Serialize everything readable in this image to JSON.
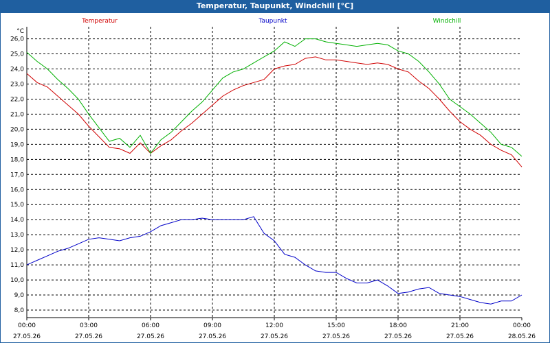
{
  "window": {
    "title": "Temperatur, Taupunkt, Windchill [°C]"
  },
  "colors": {
    "temperatur": "#d00000",
    "taupunkt": "#0000c8",
    "windchill": "#00b000",
    "titlebar": "#1f5fa0"
  },
  "chart_data": {
    "type": "line",
    "title": "Temperatur, Taupunkt, Windchill [°C]",
    "ylabel": "°C",
    "ylim": [
      7.5,
      26.8
    ],
    "xlim": [
      "2026-05-27 00:00",
      "2026-05-28 00:00"
    ],
    "grid": true,
    "legend": "top",
    "yticks": [
      "8,0",
      "9,0",
      "10,0",
      "11,0",
      "12,0",
      "13,0",
      "14,0",
      "15,0",
      "16,0",
      "17,0",
      "18,0",
      "19,0",
      "20,0",
      "21,0",
      "22,0",
      "23,0",
      "24,0",
      "25,0",
      "26,0"
    ],
    "xticks": [
      {
        "time": "00:00",
        "date": "27.05.26"
      },
      {
        "time": "03:00",
        "date": "27.05.26"
      },
      {
        "time": "06:00",
        "date": "27.05.26"
      },
      {
        "time": "09:00",
        "date": "27.05.26"
      },
      {
        "time": "12:00",
        "date": "27.05.26"
      },
      {
        "time": "15:00",
        "date": "27.05.26"
      },
      {
        "time": "18:00",
        "date": "27.05.26"
      },
      {
        "time": "21:00",
        "date": "27.05.26"
      },
      {
        "time": "00:00",
        "date": "28.05.26"
      }
    ],
    "series": [
      {
        "name": "Temperatur",
        "x": [
          "00:00",
          "00:30",
          "01:00",
          "01:30",
          "02:00",
          "02:30",
          "03:00",
          "03:30",
          "04:00",
          "04:30",
          "05:00",
          "05:30",
          "06:00",
          "06:30",
          "07:00",
          "07:30",
          "08:00",
          "08:30",
          "09:00",
          "09:30",
          "10:00",
          "10:30",
          "11:00",
          "11:30",
          "12:00",
          "12:30",
          "13:00",
          "13:30",
          "14:00",
          "14:30",
          "15:00",
          "15:30",
          "16:00",
          "16:30",
          "17:00",
          "17:30",
          "18:00",
          "18:30",
          "19:00",
          "19:30",
          "20:00",
          "20:30",
          "21:00",
          "21:30",
          "22:00",
          "22:30",
          "23:00",
          "23:30",
          "24:00"
        ],
        "y": [
          23.7,
          23.1,
          22.8,
          22.2,
          21.6,
          21.0,
          20.2,
          19.5,
          18.8,
          18.7,
          18.4,
          19.1,
          18.4,
          18.9,
          19.3,
          19.9,
          20.4,
          21.0,
          21.6,
          22.2,
          22.6,
          22.9,
          23.1,
          23.3,
          24.0,
          24.2,
          24.3,
          24.7,
          24.8,
          24.6,
          24.6,
          24.5,
          24.4,
          24.3,
          24.4,
          24.3,
          24.0,
          23.8,
          23.2,
          22.7,
          22.0,
          21.2,
          20.5,
          20.0,
          19.6,
          19.0,
          18.6,
          18.3,
          17.5
        ]
      },
      {
        "name": "Taupunkt",
        "x": [
          "00:00",
          "00:30",
          "01:00",
          "01:30",
          "02:00",
          "02:30",
          "03:00",
          "03:30",
          "04:00",
          "04:30",
          "05:00",
          "05:30",
          "06:00",
          "06:30",
          "07:00",
          "07:30",
          "08:00",
          "08:30",
          "09:00",
          "09:30",
          "10:00",
          "10:30",
          "11:00",
          "11:30",
          "12:00",
          "12:30",
          "13:00",
          "13:30",
          "14:00",
          "14:30",
          "15:00",
          "15:30",
          "16:00",
          "16:30",
          "17:00",
          "17:30",
          "18:00",
          "18:30",
          "19:00",
          "19:30",
          "20:00",
          "20:30",
          "21:00",
          "21:30",
          "22:00",
          "22:30",
          "23:00",
          "23:30",
          "24:00"
        ],
        "y": [
          11.0,
          11.3,
          11.6,
          11.9,
          12.1,
          12.4,
          12.7,
          12.8,
          12.7,
          12.6,
          12.8,
          12.9,
          13.2,
          13.6,
          13.8,
          14.0,
          14.0,
          14.1,
          14.0,
          14.0,
          14.0,
          14.0,
          14.2,
          13.1,
          12.6,
          11.7,
          11.5,
          11.0,
          10.6,
          10.5,
          10.5,
          10.1,
          9.8,
          9.8,
          10.0,
          9.6,
          9.1,
          9.2,
          9.4,
          9.5,
          9.1,
          9.0,
          8.9,
          8.7,
          8.5,
          8.4,
          8.6,
          8.6,
          9.0
        ]
      },
      {
        "name": "Windchill",
        "x": [
          "00:00",
          "00:30",
          "01:00",
          "01:30",
          "02:00",
          "02:30",
          "03:00",
          "03:30",
          "04:00",
          "04:30",
          "05:00",
          "05:30",
          "06:00",
          "06:30",
          "07:00",
          "07:30",
          "08:00",
          "08:30",
          "09:00",
          "09:30",
          "10:00",
          "10:30",
          "11:00",
          "11:30",
          "12:00",
          "12:30",
          "13:00",
          "13:30",
          "14:00",
          "14:30",
          "15:00",
          "15:30",
          "16:00",
          "16:30",
          "17:00",
          "17:30",
          "18:00",
          "18:30",
          "19:00",
          "19:30",
          "20:00",
          "20:30",
          "21:00",
          "21:30",
          "22:00",
          "22:30",
          "23:00",
          "23:30",
          "24:00"
        ],
        "y": [
          25.1,
          24.5,
          24.0,
          23.3,
          22.7,
          22.0,
          21.0,
          20.1,
          19.2,
          19.4,
          18.8,
          19.6,
          18.4,
          19.3,
          19.8,
          20.5,
          21.2,
          21.8,
          22.6,
          23.4,
          23.8,
          24.0,
          24.4,
          24.8,
          25.2,
          25.8,
          25.5,
          26.0,
          26.0,
          25.8,
          25.7,
          25.6,
          25.5,
          25.6,
          25.7,
          25.6,
          25.2,
          25.0,
          24.5,
          23.8,
          23.0,
          22.0,
          21.5,
          21.0,
          20.4,
          19.8,
          19.0,
          18.8,
          18.2
        ]
      }
    ]
  }
}
